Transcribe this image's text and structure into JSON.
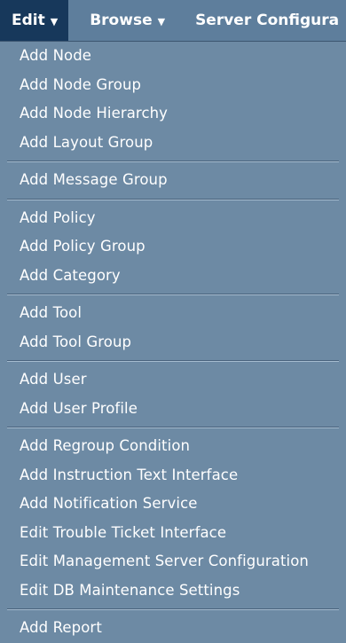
{
  "menubar": {
    "tabs": [
      {
        "label": "Edit",
        "active": true
      },
      {
        "label": "Browse",
        "active": false
      },
      {
        "label": "Server Configura",
        "active": false
      }
    ]
  },
  "dropdown": {
    "groups": [
      [
        "Add Node",
        "Add Node Group",
        "Add Node Hierarchy",
        "Add Layout Group"
      ],
      [
        "Add Message Group"
      ],
      [
        "Add Policy",
        "Add Policy Group",
        "Add Category"
      ],
      [
        "Add Tool",
        "Add Tool Group"
      ],
      [
        "Add User",
        "Add User Profile"
      ],
      [
        "Add Regroup Condition",
        "Add Instruction Text Interface",
        "Add Notification Service",
        "Edit Trouble Ticket Interface",
        "Edit Management Server Configuration",
        "Edit DB Maintenance Settings"
      ],
      [
        "Add Report"
      ]
    ]
  }
}
